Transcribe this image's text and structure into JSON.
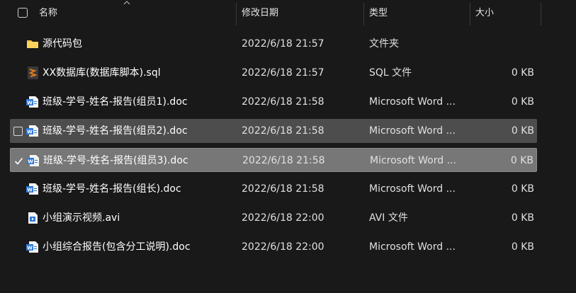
{
  "header": {
    "name_label": "名称",
    "date_label": "修改日期",
    "type_label": "类型",
    "size_label": "大小"
  },
  "rows": [
    {
      "name": "源代码包",
      "date": "",
      "type": "文件夹",
      "size": "",
      "icon": "folder-icon"
    },
    {
      "name": "XX数据库(数据库脚本).sql",
      "date": "2022/6/18 21:57",
      "type": "SQL 文件",
      "size": "0 KB",
      "icon": "sql-file-icon"
    },
    {
      "name": "班级-学号-姓名-报告(组员1).doc",
      "date": "2022/6/18 21:58",
      "type": "Microsoft Word ...",
      "size": "0 KB",
      "icon": "word-doc-icon"
    },
    {
      "name": "班级-学号-姓名-报告(组员2).doc",
      "date": "2022/6/18 21:58",
      "type": "Microsoft Word ...",
      "size": "0 KB",
      "icon": "word-doc-icon",
      "state": "hover"
    },
    {
      "name": "班级-学号-姓名-报告(组员3).doc",
      "date": "2022/6/18 21:58",
      "type": "Microsoft Word ...",
      "size": "0 KB",
      "icon": "word-doc-icon",
      "state": "selected"
    },
    {
      "name": "班级-学号-姓名-报告(组长).doc",
      "date": "2022/6/18 21:58",
      "type": "Microsoft Word ...",
      "size": "0 KB",
      "icon": "word-doc-icon"
    },
    {
      "name": "小组演示视频.avi",
      "date": "2022/6/18 22:00",
      "type": "AVI 文件",
      "size": "0 KB",
      "icon": "video-file-icon"
    },
    {
      "name": "小组综合报告(包含分工说明).doc",
      "date": "2022/6/18 22:00",
      "type": "Microsoft Word ...",
      "size": "0 KB",
      "icon": "word-doc-icon"
    }
  ],
  "folder_date": "2022/6/18 21:57",
  "colors": {
    "background": "#191919",
    "hover_row": "#4d4d4d",
    "selected_row": "#777777",
    "checkmark_accent": "#4cc2ff",
    "folder": "#f5c04a",
    "word_blue": "#2b78d8",
    "sql_orange": "#e07a1f"
  }
}
